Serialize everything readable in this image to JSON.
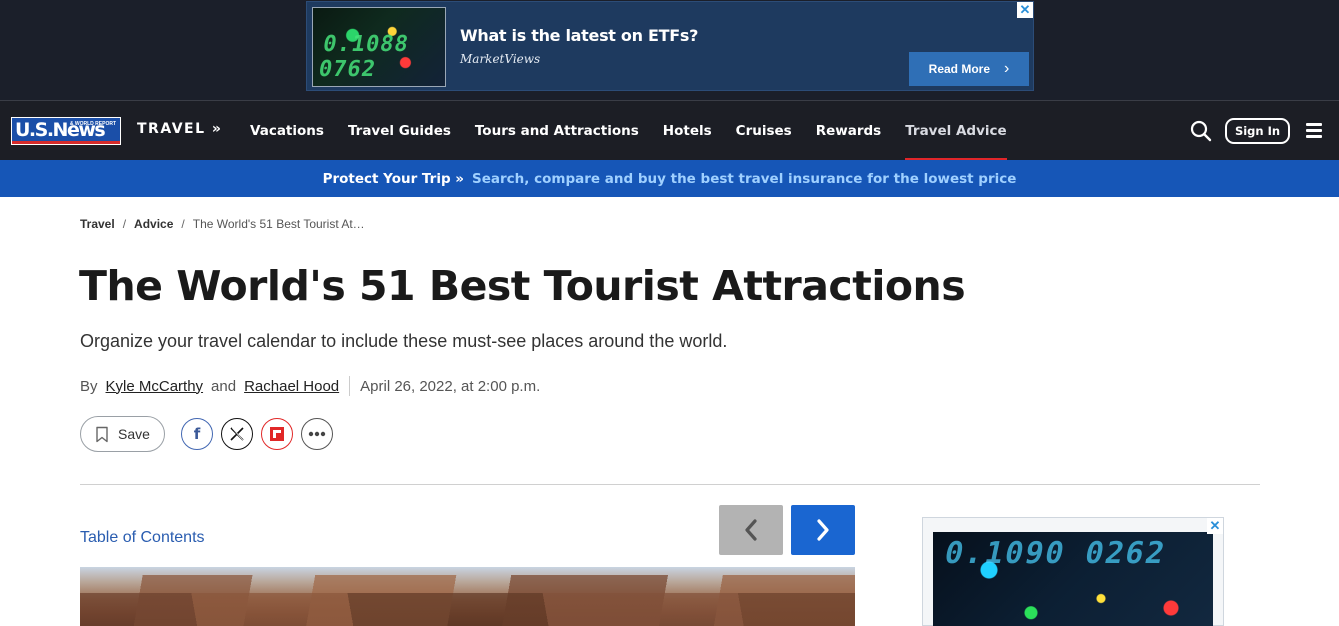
{
  "top_ad": {
    "thumb_digits": "0.1088 0762",
    "headline": "What is the latest on ETFs?",
    "brand": "MarketViews",
    "cta": "Read More",
    "close": "✕"
  },
  "nav": {
    "logo": "U.S.News",
    "logo_small": "& WORLD REPORT",
    "section": "TRAVEL »",
    "items": [
      {
        "label": "Vacations"
      },
      {
        "label": "Travel Guides"
      },
      {
        "label": "Tours and Attractions"
      },
      {
        "label": "Hotels"
      },
      {
        "label": "Cruises"
      },
      {
        "label": "Rewards"
      },
      {
        "label": "Travel Advice"
      }
    ],
    "active_index": 6,
    "sign_in": "Sign In"
  },
  "promo": {
    "lead": "Protect Your Trip »",
    "text": "Search, compare and buy the best travel insurance for the lowest price"
  },
  "breadcrumb": {
    "items": [
      "Travel",
      "Advice"
    ],
    "separator": "/",
    "current": "The World's 51 Best Tourist At…"
  },
  "article": {
    "title": "The World's 51 Best Tourist Attractions",
    "subtitle": "Organize your travel calendar to include these must-see places around the world.",
    "by": "By",
    "author1": "Kyle McCarthy",
    "and": "and",
    "author2": "Rachael Hood",
    "date": "April 26, 2022, at 2:00 p.m.",
    "save": "Save",
    "facebook_glyph": "f",
    "toc": "Table of Contents"
  },
  "side_ad": {
    "digits": "0.1090 0262",
    "close": "✕"
  },
  "colors": {
    "nav_bg": "#1c1e25",
    "promo_bg": "#1656b7",
    "accent_red": "#e0262a",
    "next_btn": "#1a66d1",
    "link": "#2a5db0"
  }
}
